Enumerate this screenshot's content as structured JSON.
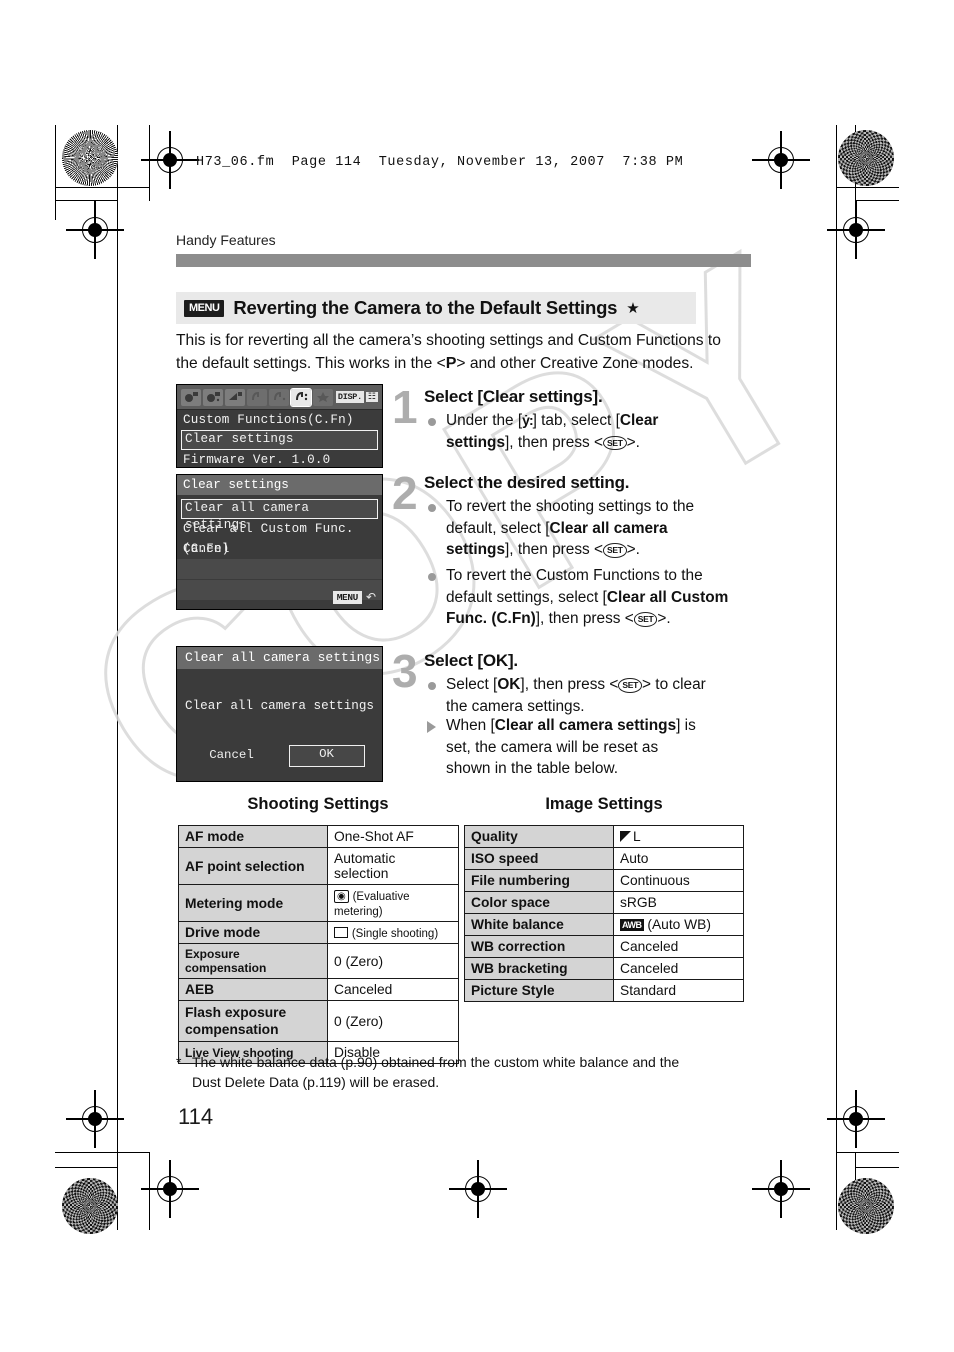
{
  "runhead": "H73_06.fm  Page 114  Tuesday, November 13, 2007  7:38 PM",
  "chapter": "Handy Features",
  "page_number": "114",
  "watermark": "COPY",
  "title": {
    "menu_badge": "MENU",
    "text": "Reverting the Camera to the Default Settings",
    "star": "★"
  },
  "intro": {
    "line1": "This is for reverting all the camera’s shooting settings and Custom Functions to",
    "line2_a": "the default settings. This works in the <",
    "mode": "P",
    "line2_b": "> and other Creative Zone modes."
  },
  "lcd1": {
    "tabs": [
      "shoot1",
      "shoot2",
      "playback",
      "setup1",
      "setup2",
      "setup3",
      "mymenu"
    ],
    "active_tab_index": 5,
    "disp_label": "DISP.",
    "disp_grid": "☷",
    "rows": [
      {
        "label": "Custom Functions(C.Fn)",
        "selected": false
      },
      {
        "label": "Clear settings",
        "selected": true
      },
      {
        "label": "Firmware Ver. 1.0.0",
        "selected": false
      }
    ]
  },
  "lcd2": {
    "title": "Clear settings",
    "rows": [
      {
        "label": "Clear all camera settings",
        "selected": true
      },
      {
        "label": "Clear all Custom Func. (C.Fn)",
        "selected": false
      },
      {
        "label": "Cancel",
        "selected": false
      }
    ],
    "menu_pill": "MENU",
    "back_arrow": "↶"
  },
  "lcd3": {
    "title": "Clear all camera settings",
    "message": "Clear all camera settings",
    "buttons": [
      {
        "label": "Cancel",
        "selected": false
      },
      {
        "label": "OK",
        "selected": true
      }
    ]
  },
  "steps": [
    {
      "number": "1",
      "title": "Select [Clear settings].",
      "bullets": [
        {
          "marker": "dot",
          "html_key": "b1"
        }
      ],
      "b1_l1_a": "Under the [",
      "b1_l1_icon": "ẏ:",
      "b1_l1_b": "] tab, select [",
      "b1_l1_bold": "Clear",
      "b1_l2_bold": "settings",
      "b1_l2_b": "], then press <",
      "b1_set": "SET",
      "b1_l2_c": ">."
    },
    {
      "number": "2",
      "title": "Select the desired setting.",
      "b1_l1": "To revert the shooting settings to the",
      "b1_l2_a": "default, select [",
      "b1_l2_bold": "Clear all camera",
      "b1_l3_bold": "settings",
      "b1_l3_b": "], then press <",
      "b1_set": "SET",
      "b1_l3_c": ">.",
      "b2_l1": "To revert the Custom Functions to the",
      "b2_l2_a": "default settings, select [",
      "b2_l2_bold": "Clear all Custom",
      "b2_l3_bold": "Func. (C.Fn)",
      "b2_l3_b": "], then press <",
      "b2_set": "SET",
      "b2_l3_c": ">."
    },
    {
      "number": "3",
      "title": "Select [OK].",
      "b1_l1_a": "Select [",
      "b1_l1_bold": "OK",
      "b1_l1_b": "], then press <",
      "b1_set": "SET",
      "b1_l1_c": "> to clear",
      "b1_l2": "the camera settings.",
      "b2_l1_a": "When [",
      "b2_l1_bold": "Clear all camera settings",
      "b2_l1_b": "] is",
      "b2_l2": "set, the camera will be reset as",
      "b2_l3": "shown in the table below."
    }
  ],
  "tables": {
    "shooting": {
      "caption": "Shooting Settings",
      "rows": [
        {
          "key": "AF mode",
          "value": "One-Shot AF",
          "small_key": false
        },
        {
          "key": "AF point selection",
          "value": "Automatic selection",
          "small_key": false
        },
        {
          "key": "Metering mode",
          "value": "(Evaluative metering)",
          "icon": "metering",
          "small_key": false
        },
        {
          "key": "Drive mode",
          "value": "(Single shooting)",
          "icon": "drive",
          "small_key": false
        },
        {
          "key": "Exposure compensation",
          "value": "0 (Zero)",
          "small_key": true
        },
        {
          "key": "AEB",
          "value": "Canceled",
          "small_key": false
        },
        {
          "key": "Flash exposure compensation",
          "value": "0 (Zero)",
          "small_key": false
        },
        {
          "key": "Live View shooting",
          "value": "Disable",
          "small_key": true
        }
      ]
    },
    "image": {
      "caption": "Image Settings",
      "rows": [
        {
          "key": "Quality",
          "value": "L",
          "icon": "quality"
        },
        {
          "key": "ISO speed",
          "value": "Auto"
        },
        {
          "key": "File numbering",
          "value": "Continuous"
        },
        {
          "key": "Color space",
          "value": "sRGB"
        },
        {
          "key": "White balance",
          "value": "(Auto WB)",
          "icon": "awb"
        },
        {
          "key": "WB correction",
          "value": "Canceled"
        },
        {
          "key": "WB bracketing",
          "value": "Canceled"
        },
        {
          "key": "Picture Style",
          "value": "Standard"
        }
      ]
    }
  },
  "footnote": {
    "star": "*",
    "line1": "The white balance data (p.90) obtained from the custom white balance and the",
    "line2": "Dust Delete Data (p.119) will be erased."
  }
}
